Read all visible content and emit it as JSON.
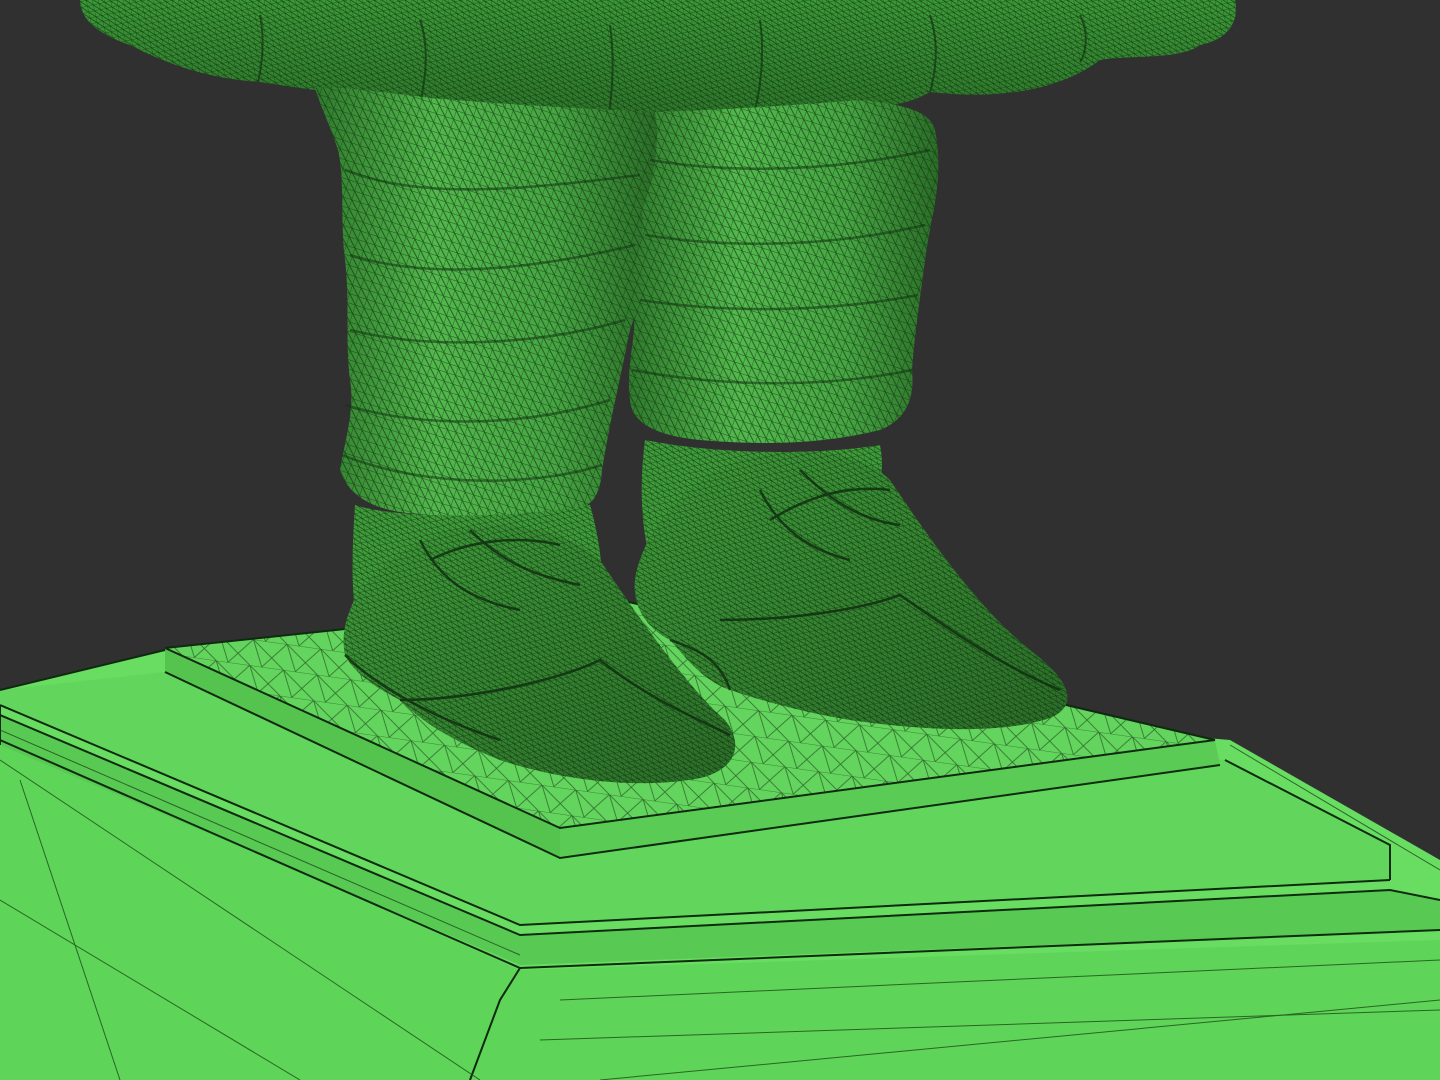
{
  "viewport": {
    "background_color": "#303030",
    "render_mode": "wireframe-on-shaded",
    "mesh_color": "#5fcf5a",
    "mesh_shadow_color": "#2f7a2c",
    "wire_color": "#0f2a0f"
  },
  "scene": {
    "subject": "statue-lower-body",
    "parts": [
      "coat-hem",
      "left-trouser-leg",
      "right-trouser-leg",
      "left-shoe",
      "right-shoe",
      "pedestal-top-plinth",
      "pedestal-middle-step",
      "pedestal-base-block"
    ]
  }
}
